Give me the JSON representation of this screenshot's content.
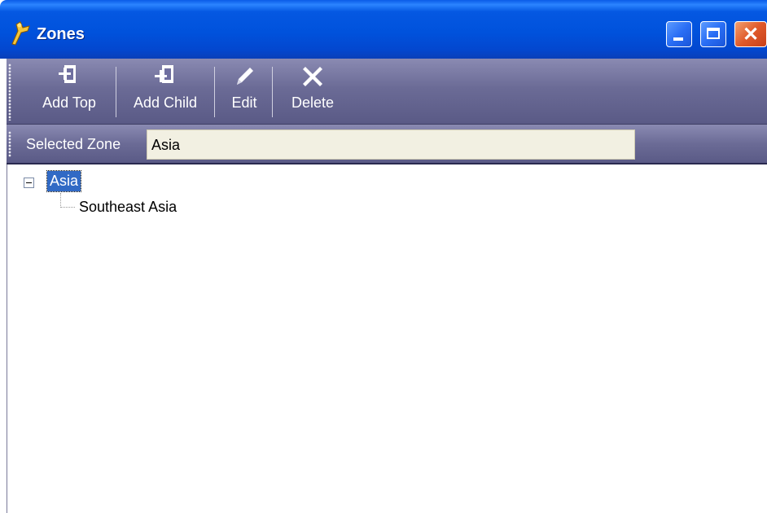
{
  "window": {
    "title": "Zones"
  },
  "toolbar": {
    "buttons": [
      {
        "label": "Add Top",
        "icon": "add-top-icon"
      },
      {
        "label": "Add Child",
        "icon": "add-child-icon"
      },
      {
        "label": "Edit",
        "icon": "pencil-icon"
      },
      {
        "label": "Delete",
        "icon": "delete-x-icon"
      }
    ]
  },
  "zonebar": {
    "label": "Selected Zone",
    "value": "Asia"
  },
  "tree": {
    "nodes": [
      {
        "label": "Asia",
        "expanded": true,
        "selected": true,
        "children": [
          {
            "label": "Southeast Asia"
          }
        ]
      }
    ]
  },
  "colors": {
    "title_bar": "#0052dc",
    "toolbar": "#6b6b96",
    "selection": "#316ac5",
    "field_bg": "#f2f0e2"
  }
}
